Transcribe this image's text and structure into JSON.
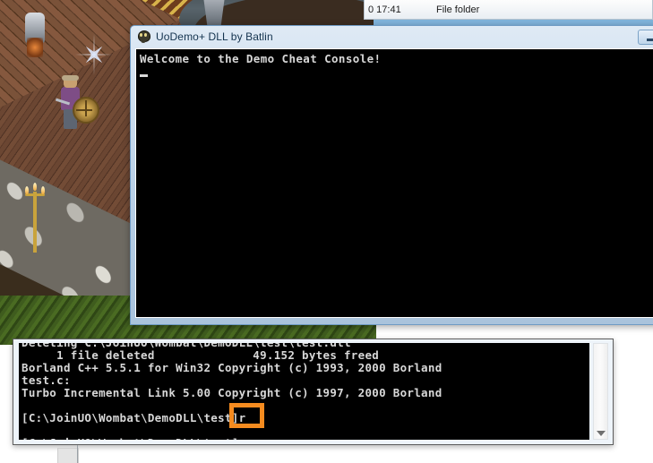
{
  "explorer": {
    "date_column": "0 17:41",
    "type_column": "File folder"
  },
  "demo_window": {
    "title": "UoDemo+ DLL by Batlin",
    "icon": "skull-icon",
    "minimize_label": "Minimize",
    "console_text": "Welcome to the Demo Cheat Console!"
  },
  "build_window": {
    "lines": [
      "Deleting C:\\JoinUO\\Wombat\\DemoDLL\\test\\test.dll",
      "     1 file deleted              49.152 bytes freed",
      "Borland C++ 5.5.1 for Win32 Copyright (c) 1993, 2000 Borland",
      "test.c:",
      "Turbo Incremental Link 5.00 Copyright (c) 1997, 2000 Borland",
      "",
      "[C:\\JoinUO\\Wombat\\DemoDLL\\test]r",
      "",
      "[C:\\JoinUO\\Wombat\\DemoDLL\\test]"
    ],
    "scrollbar": "vertical-scrollbar"
  },
  "annotation": {
    "color": "#f58b1f",
    "target_text": "t]r"
  },
  "colors": {
    "accent_orange": "#f58b1f",
    "aero_blue": "#7fb4dc",
    "terminal_bg": "#000000",
    "terminal_fg": "#d8d8d8"
  },
  "game_scene": {
    "name": "ultima-online-game-scene"
  }
}
